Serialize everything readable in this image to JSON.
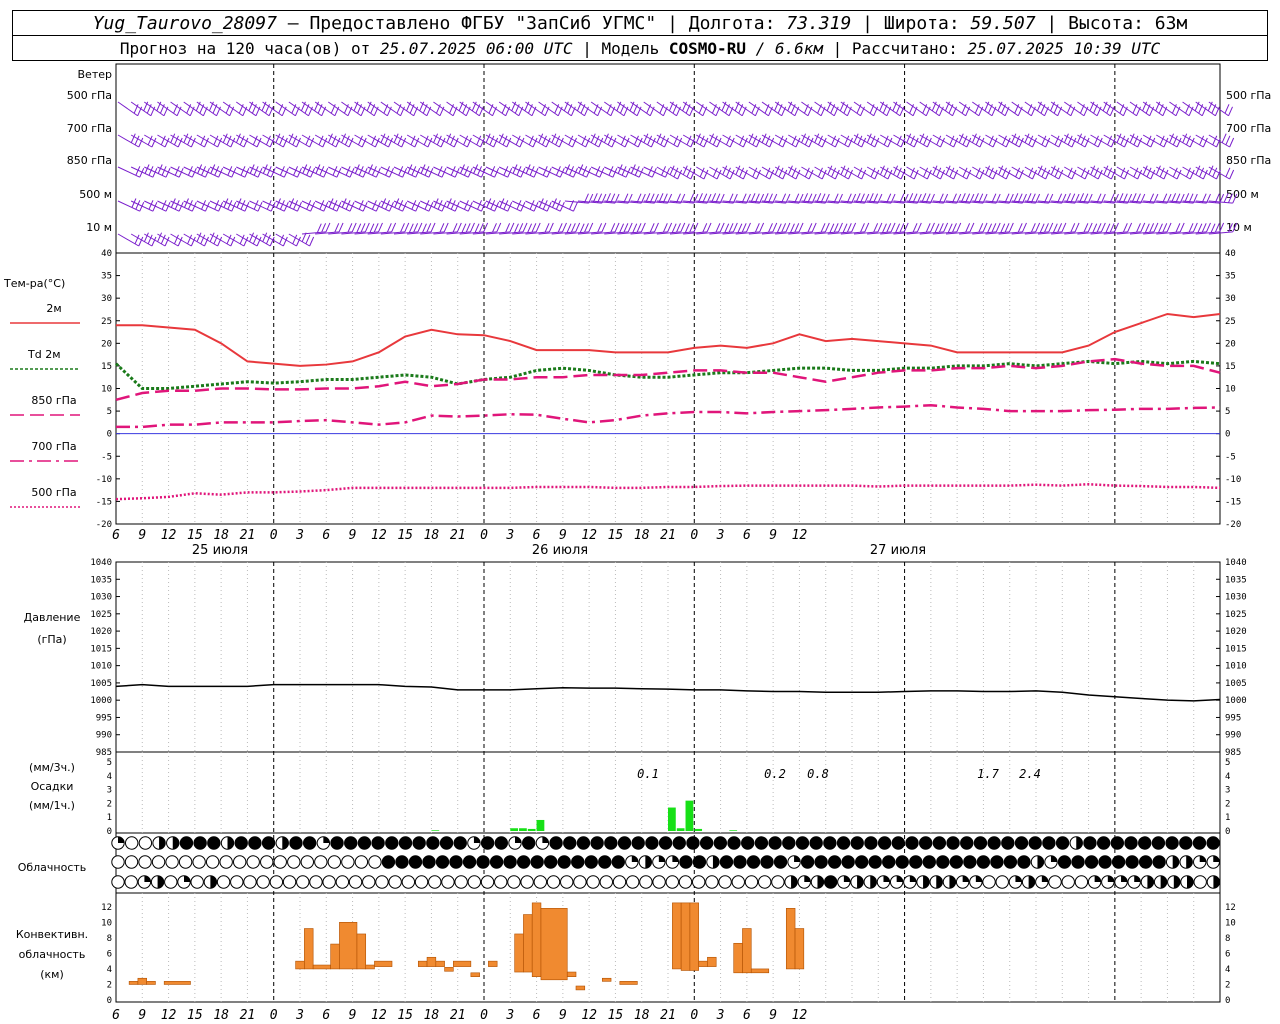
{
  "header": {
    "station": "Yug_Taurovo_28097",
    "provider": " – Предоставлено ФГБУ \"ЗапСиб УГМС\" | Долгота: ",
    "lon": "73.319",
    "lat_label": " | Широта: ",
    "lat": "59.507",
    "alt_label": " | Высота: ",
    "alt": "63м",
    "forecast_prefix": "Прогноз на 120 часа(ов) от ",
    "forecast_time": "25.07.2025 06:00 UTC",
    "model_prefix": " | Модель ",
    "model": "COSMO-RU",
    "model_res": " / 6.6км",
    "calc_prefix": " | Рассчитано: ",
    "calc_time": "25.07.2025 10:39 UTC"
  },
  "colors": {
    "wind": "#7a1ecc",
    "t2m": "#e8383c",
    "td2m": "#1a7a1a",
    "t850": "#e0157a",
    "t700": "#e0157a",
    "t500": "#e0157a",
    "zero_line": "#3a3ae0",
    "pressure": "#000000",
    "precip": "#17e017",
    "convective": "#f08a30"
  },
  "time_axis": {
    "hours": [
      "6",
      "9",
      "12",
      "15",
      "18",
      "21",
      "0",
      "3",
      "6",
      "9",
      "12",
      "15",
      "18",
      "21",
      "0",
      "3",
      "6",
      "9",
      "12",
      "15",
      "18",
      "21",
      "0",
      "3",
      "6",
      "9",
      "12"
    ],
    "days": [
      "25 июля",
      "26 июля",
      "27 июля"
    ]
  },
  "wind_panel": {
    "title": "Ветер",
    "levels": [
      "500 гПа",
      "700 гПа",
      "850 гПа",
      "500 м",
      "10 м"
    ]
  },
  "temperature_panel": {
    "title": "Тем-ра(°С)",
    "legend": [
      {
        "label": "2м",
        "style": "solid",
        "color_key": "t2m"
      },
      {
        "label": "Td 2м",
        "style": "dotted",
        "color_key": "td2m"
      },
      {
        "label": "850 гПа",
        "style": "longdash",
        "color_key": "t850"
      },
      {
        "label": "700 гПа",
        "style": "dashdot",
        "color_key": "t700"
      },
      {
        "label": "500 гПа",
        "style": "dot",
        "color_key": "t500"
      }
    ],
    "yticks": [
      "40",
      "35",
      "30",
      "25",
      "20",
      "15",
      "10",
      "5",
      "0",
      "-5",
      "-10",
      "-15",
      "-20"
    ]
  },
  "pressure_panel": {
    "title": "Давление",
    "unit": "(гПа)",
    "yticks": [
      "1040",
      "1035",
      "1030",
      "1025",
      "1020",
      "1015",
      "1010",
      "1005",
      "1000",
      "995",
      "990",
      "985"
    ]
  },
  "precip_panel": {
    "unit_3h": "(мм/3ч.)",
    "title": "Осадки",
    "unit_1h": "(мм/1ч.)",
    "yticks": [
      "5",
      "4",
      "3",
      "2",
      "1",
      "0"
    ],
    "annotations": [
      "0.1",
      "0.2",
      "0.8",
      "1.7",
      "2.4"
    ]
  },
  "cloud_panel": {
    "title": "Облачность"
  },
  "convective_panel": {
    "title1": "Конвективн.",
    "title2": "облачность",
    "unit": "(км)",
    "yticks": [
      "12",
      "10",
      "8",
      "6",
      "4",
      "2",
      "0"
    ]
  },
  "chart_data": [
    {
      "type": "line",
      "name": "temperature",
      "x_hours": [
        0,
        3,
        6,
        9,
        12,
        15,
        18,
        21,
        24,
        27,
        30,
        33,
        36,
        39,
        42,
        45,
        48,
        51,
        54,
        57,
        60,
        63,
        66,
        69,
        72,
        75,
        78,
        81,
        84,
        87,
        90,
        93,
        96,
        99,
        102,
        105,
        108,
        111,
        114,
        117,
        120,
        123,
        126
      ],
      "ylim": [
        -20,
        40
      ],
      "series": [
        {
          "name": "2м",
          "color_key": "t2m",
          "values": [
            24,
            24,
            23.5,
            23,
            20,
            16,
            15.5,
            15,
            15.3,
            16,
            18,
            21.5,
            23,
            22,
            21.8,
            20.5,
            18.5,
            18.5,
            18.5,
            18,
            18,
            18,
            19,
            19.5,
            19,
            20,
            22,
            20.5,
            21,
            20.5,
            20,
            19.5,
            18,
            18,
            18,
            18,
            18,
            19.5,
            22.5,
            24.5,
            26.5,
            25.8,
            26.5
          ]
        },
        {
          "name": "Td 2м",
          "color_key": "td2m",
          "values": [
            15.5,
            10,
            10,
            10.5,
            11,
            11.5,
            11.2,
            11.5,
            12,
            12,
            12.5,
            13,
            12.5,
            11,
            12,
            12.5,
            14,
            14.5,
            14,
            13,
            12.5,
            12.5,
            13,
            13.5,
            13.5,
            14,
            14.5,
            14.5,
            14,
            14,
            14.5,
            14.5,
            15,
            15,
            15.5,
            15,
            15.5,
            16,
            15.5,
            16,
            15.5,
            16,
            15.5
          ]
        },
        {
          "name": "850 гПа",
          "color_key": "t850",
          "values": [
            7.5,
            9,
            9.5,
            9.5,
            10,
            10,
            9.8,
            9.8,
            10,
            10,
            10.5,
            11.5,
            10.5,
            11,
            12,
            12,
            12.5,
            12.5,
            13,
            13,
            13,
            13.5,
            14,
            14,
            13.5,
            13.5,
            12.5,
            11.5,
            12.5,
            13.5,
            14,
            14,
            14.5,
            14.5,
            15,
            14.5,
            15,
            16,
            16.5,
            15.5,
            15,
            15,
            13.5
          ]
        },
        {
          "name": "700 гПа",
          "color_key": "t700",
          "values": [
            1.5,
            1.5,
            2,
            2,
            2.5,
            2.5,
            2.5,
            2.8,
            3,
            2.5,
            2,
            2.5,
            4,
            3.8,
            4,
            4.3,
            4.2,
            3.3,
            2.5,
            3,
            4,
            4.5,
            4.8,
            4.8,
            4.5,
            4.8,
            5,
            5.2,
            5.5,
            5.8,
            6,
            6.3,
            5.8,
            5.5,
            5,
            5,
            5,
            5.2,
            5.3,
            5.5,
            5.5,
            5.7,
            5.8
          ]
        },
        {
          "name": "500 гПа",
          "color_key": "t500",
          "values": [
            -14.5,
            -14.3,
            -14,
            -13.2,
            -13.5,
            -13,
            -13,
            -12.8,
            -12.5,
            -12,
            -12,
            -12,
            -12,
            -12,
            -12,
            -12,
            -11.8,
            -11.8,
            -11.8,
            -12,
            -12,
            -11.8,
            -11.8,
            -11.6,
            -11.5,
            -11.5,
            -11.5,
            -11.5,
            -11.5,
            -11.7,
            -11.5,
            -11.5,
            -11.5,
            -11.5,
            -11.5,
            -11.3,
            -11.5,
            -11.2,
            -11.5,
            -11.6,
            -11.8,
            -11.8,
            -12
          ]
        }
      ]
    },
    {
      "type": "line",
      "name": "pressure",
      "x_hours": [
        0,
        3,
        6,
        9,
        12,
        15,
        18,
        21,
        24,
        27,
        30,
        33,
        36,
        39,
        42,
        45,
        48,
        51,
        54,
        57,
        60,
        63,
        66,
        69,
        72,
        75,
        78,
        81,
        84,
        87,
        90,
        93,
        96,
        99,
        102,
        105,
        108,
        111,
        114,
        117,
        120,
        123,
        126
      ],
      "ylim": [
        985,
        1040
      ],
      "series": [
        {
          "name": "Давление",
          "color_key": "pressure",
          "values": [
            1004,
            1004.5,
            1004,
            1004,
            1004,
            1004,
            1004.5,
            1004.5,
            1004.5,
            1004.5,
            1004.5,
            1004,
            1003.8,
            1003,
            1003,
            1003,
            1003.3,
            1003.6,
            1003.5,
            1003.5,
            1003.3,
            1003.2,
            1003,
            1003,
            1002.7,
            1002.5,
            1002.5,
            1002.3,
            1002.3,
            1002.3,
            1002.5,
            1002.7,
            1002.7,
            1002.5,
            1002.5,
            1002.7,
            1002.3,
            1001.5,
            1001,
            1000.5,
            1000,
            999.8,
            1000.2
          ]
        }
      ]
    },
    {
      "type": "bar",
      "name": "precipitation_mm_per_hour",
      "x_hours": [
        69,
        70,
        71,
        72,
        73,
        74,
        75,
        76,
        77,
        78,
        79,
        80,
        81,
        82,
        83,
        84,
        85,
        86,
        87,
        88,
        89,
        90,
        91,
        92,
        93,
        94,
        95,
        96,
        97,
        98,
        99,
        100,
        101,
        102,
        103,
        104,
        105,
        106,
        107,
        108,
        109,
        110,
        111,
        112,
        113,
        114,
        115,
        116,
        117,
        118,
        119,
        120
      ],
      "note": "hourly bars with visible values; other hours zero",
      "bars": [
        {
          "x": 36.5,
          "value": 0.05
        },
        {
          "x": 45.5,
          "value": 0.2
        },
        {
          "x": 46.5,
          "value": 0.2
        },
        {
          "x": 47.5,
          "value": 0.15
        },
        {
          "x": 48.5,
          "value": 0.8
        },
        {
          "x": 63.5,
          "value": 1.7
        },
        {
          "x": 64.5,
          "value": 0.2
        },
        {
          "x": 65.5,
          "value": 2.2
        },
        {
          "x": 66.5,
          "value": 0.15
        },
        {
          "x": 70.5,
          "value": 0.05
        }
      ]
    },
    {
      "type": "bar",
      "name": "convective_cloud_km",
      "ylim": [
        0,
        13
      ],
      "bars": [
        {
          "x0": 1.5,
          "x1": 2.5,
          "bottom": 2.0,
          "top": 2.4
        },
        {
          "x0": 2.5,
          "x1": 3.5,
          "bottom": 2.0,
          "top": 2.8
        },
        {
          "x0": 3.5,
          "x1": 4.5,
          "bottom": 2.0,
          "top": 2.4
        },
        {
          "x0": 5.5,
          "x1": 8.5,
          "bottom": 2.0,
          "top": 2.4
        },
        {
          "x0": 20.5,
          "x1": 21.5,
          "bottom": 4.0,
          "top": 5.0
        },
        {
          "x0": 21.5,
          "x1": 22.5,
          "bottom": 4.0,
          "top": 9.2
        },
        {
          "x0": 22.5,
          "x1": 24.5,
          "bottom": 4.0,
          "top": 4.5
        },
        {
          "x0": 24.5,
          "x1": 25.5,
          "bottom": 4.0,
          "top": 7.2
        },
        {
          "x0": 25.5,
          "x1": 27.5,
          "bottom": 4.0,
          "top": 10.0
        },
        {
          "x0": 27.5,
          "x1": 28.5,
          "bottom": 4.0,
          "top": 8.5
        },
        {
          "x0": 28.5,
          "x1": 29.5,
          "bottom": 4.0,
          "top": 4.5
        },
        {
          "x0": 29.5,
          "x1": 31.5,
          "bottom": 4.3,
          "top": 5.0
        },
        {
          "x0": 34.5,
          "x1": 35.5,
          "bottom": 4.3,
          "top": 5.0
        },
        {
          "x0": 35.5,
          "x1": 36.5,
          "bottom": 4.3,
          "top": 5.5
        },
        {
          "x0": 36.5,
          "x1": 37.5,
          "bottom": 4.3,
          "top": 5.0
        },
        {
          "x0": 37.5,
          "x1": 38.5,
          "bottom": 3.7,
          "top": 4.2
        },
        {
          "x0": 38.5,
          "x1": 40.5,
          "bottom": 4.3,
          "top": 5.0
        },
        {
          "x0": 40.5,
          "x1": 41.5,
          "bottom": 3.0,
          "top": 3.5
        },
        {
          "x0": 42.5,
          "x1": 43.5,
          "bottom": 4.3,
          "top": 5.0
        },
        {
          "x0": 45.5,
          "x1": 46.5,
          "bottom": 3.6,
          "top": 8.5
        },
        {
          "x0": 46.5,
          "x1": 47.5,
          "bottom": 3.6,
          "top": 11.0
        },
        {
          "x0": 47.5,
          "x1": 48.5,
          "bottom": 3.0,
          "top": 12.5
        },
        {
          "x0": 48.5,
          "x1": 51.5,
          "bottom": 2.6,
          "top": 11.8
        },
        {
          "x0": 51.5,
          "x1": 52.5,
          "bottom": 3.0,
          "top": 3.6
        },
        {
          "x0": 52.5,
          "x1": 53.5,
          "bottom": 1.3,
          "top": 1.8
        },
        {
          "x0": 55.5,
          "x1": 56.5,
          "bottom": 2.4,
          "top": 2.8
        },
        {
          "x0": 57.5,
          "x1": 59.5,
          "bottom": 2.0,
          "top": 2.4
        },
        {
          "x0": 63.5,
          "x1": 64.5,
          "bottom": 4.0,
          "top": 12.5
        },
        {
          "x0": 64.5,
          "x1": 65.5,
          "bottom": 3.8,
          "top": 12.5
        },
        {
          "x0": 65.5,
          "x1": 66.5,
          "bottom": 3.8,
          "top": 12.5
        },
        {
          "x0": 66.5,
          "x1": 67.5,
          "bottom": 4.3,
          "top": 5.0
        },
        {
          "x0": 67.5,
          "x1": 68.5,
          "bottom": 4.3,
          "top": 5.5
        },
        {
          "x0": 70.5,
          "x1": 71.5,
          "bottom": 3.5,
          "top": 7.3
        },
        {
          "x0": 71.5,
          "x1": 72.5,
          "bottom": 3.5,
          "top": 9.2
        },
        {
          "x0": 72.5,
          "x1": 74.5,
          "bottom": 3.5,
          "top": 4.0
        },
        {
          "x0": 76.5,
          "x1": 77.5,
          "bottom": 4.0,
          "top": 11.8
        },
        {
          "x0": 77.5,
          "x1": 78.5,
          "bottom": 4.0,
          "top": 9.2
        }
      ]
    }
  ],
  "cloud_rows": [
    "qoohhfffhfffhffqffffffffffqffqfqffffffffffffffffffffffffffffffffffffffhffffffffff",
    "ooooooooooooooooooooffffffffffffffffffqhqqffhfffffqfffffffffffffffffhqffffffffhhqq",
    "ooqhoqohooooooooooooooooooooooooooooooooooooooooooohqhfqhhqqqhhhqqooqhqoooqqqqhhhhoh"
  ]
}
